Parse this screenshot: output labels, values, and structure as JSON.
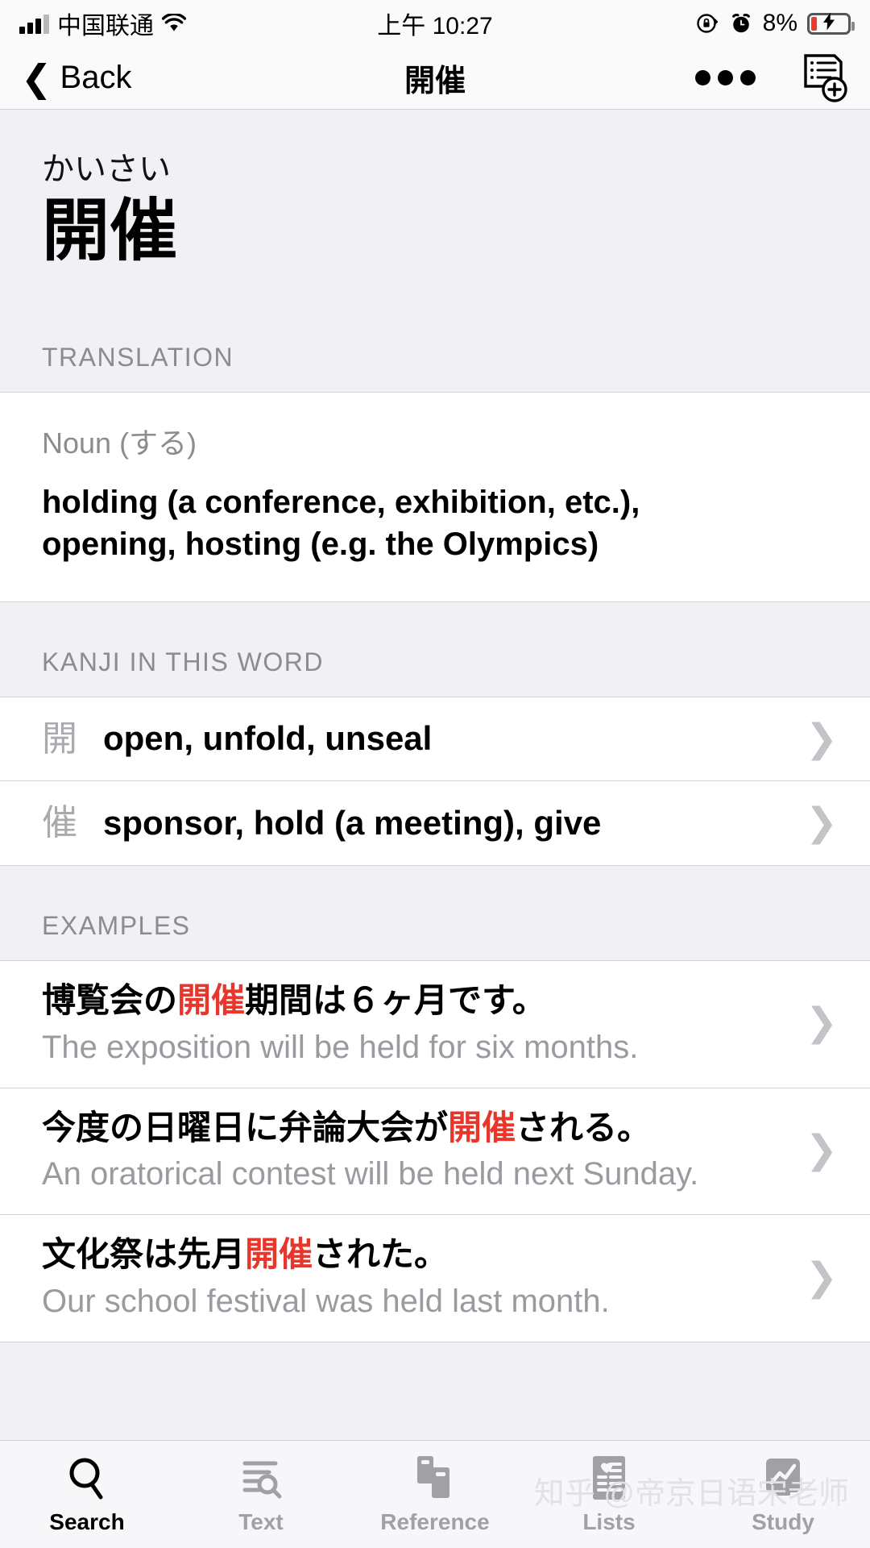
{
  "status_bar": {
    "carrier": "中国联通",
    "time": "上午 10:27",
    "battery_percent": "8%",
    "icons": [
      "signal-bars",
      "wifi-icon",
      "rotation-lock-icon",
      "alarm-clock-icon",
      "battery-charging-icon"
    ]
  },
  "nav_bar": {
    "back_label": "Back",
    "title": "開催",
    "more_icon": "more-dots-icon",
    "add_to_list_icon": "add-to-list-icon"
  },
  "headword": {
    "reading": "かいさい",
    "word": "開催"
  },
  "sections": {
    "translation_header": "TRANSLATION",
    "kanji_header": "KANJI IN THIS WORD",
    "examples_header": "EXAMPLES"
  },
  "translation": {
    "part_of_speech": "Noun (する)",
    "gloss_line1": "holding (a conference, exhibition, etc.),",
    "gloss_line2": "opening, hosting (e.g. the Olympics)"
  },
  "kanji": [
    {
      "char": "開",
      "meaning": "open, unfold, unseal"
    },
    {
      "char": "催",
      "meaning": "sponsor, hold (a meeting), give"
    }
  ],
  "examples": [
    {
      "jp_before": "博覧会の",
      "jp_highlight": "開催",
      "jp_after": "期間は６ヶ月です。",
      "en": "The exposition will be held for six months."
    },
    {
      "jp_before": "今度の日曜日に弁論大会が",
      "jp_highlight": "開催",
      "jp_after": "される。",
      "en": "An oratorical contest will be held next Sunday."
    },
    {
      "jp_before": "文化祭は先月",
      "jp_highlight": "開催",
      "jp_after": "された。",
      "en": "Our school festival was held last month."
    }
  ],
  "tab_bar": {
    "tabs": [
      {
        "label": "Search",
        "icon": "magnifier-icon",
        "active": true
      },
      {
        "label": "Text",
        "icon": "text-lines-search-icon",
        "active": false
      },
      {
        "label": "Reference",
        "icon": "books-icon",
        "active": false
      },
      {
        "label": "Lists",
        "icon": "list-heart-icon",
        "active": false
      },
      {
        "label": "Study",
        "icon": "chart-card-icon",
        "active": false
      }
    ]
  },
  "watermark": "知乎 @帝京日语宋老师",
  "colors": {
    "highlight_red": "#e8362c",
    "section_bg": "#f1f1f5",
    "muted_text": "#8b8b90"
  }
}
